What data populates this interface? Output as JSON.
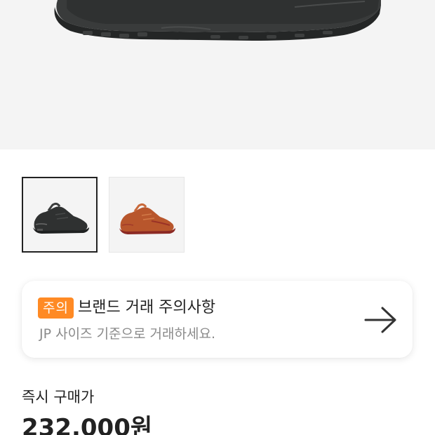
{
  "product": {
    "hero_image_icon": "black-sneaker-image",
    "thumbnails": [
      {
        "name": "black-colorway",
        "icon": "black-sneaker-thumbnail",
        "selected": true,
        "color": "#2b2d2d"
      },
      {
        "name": "orange-colorway",
        "icon": "orange-sneaker-thumbnail",
        "selected": false,
        "color": "#b8562c"
      }
    ]
  },
  "notice": {
    "badge": "주의",
    "title": "브랜드 거래 주의사항",
    "description": "JP 사이즈 기준으로 거래하세요.",
    "arrow_icon": "arrow-right-icon",
    "accent_color": "#ff8a24"
  },
  "price": {
    "label": "즉시 구매가",
    "value": "232,000원"
  }
}
